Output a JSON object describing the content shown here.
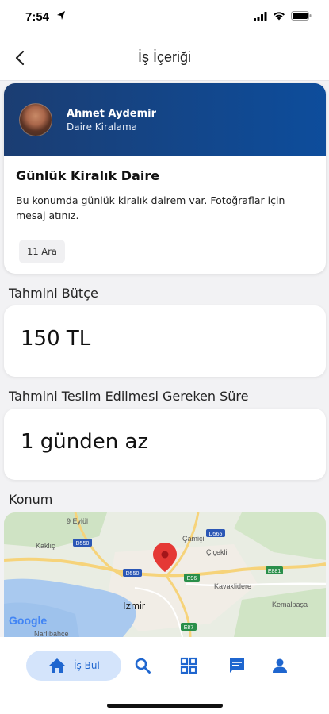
{
  "status_bar": {
    "time": "7:54"
  },
  "nav": {
    "title": "İş İçeriği"
  },
  "job": {
    "user_name": "Ahmet Aydemir",
    "user_category": "Daire Kiralama",
    "title": "Günlük Kiralık Daire",
    "description": "Bu konumda günlük kiralık dairem var. Fotoğraflar için mesaj atınız.",
    "date": "11 Ara"
  },
  "budget": {
    "label": "Tahmini Bütçe",
    "value": "150 TL"
  },
  "duration": {
    "label": "Tahmini Teslim Edilmesi Gereken Süre",
    "value": "1 günden az"
  },
  "location": {
    "label": "Konum",
    "map_labels": {
      "eylul": "9 Eylül",
      "camici": "Çamiçi",
      "kaklic": "Kaklıç",
      "cicekli": "Çiçekli",
      "kavaklidere": "Kavaklidere",
      "izmir": "İzmir",
      "kemalpasa": "Kemalpaşa",
      "narlibahce": "Narlıbahçe",
      "google": "Google",
      "d565": "D565",
      "d550_top": "D550",
      "d550_mid": "D550",
      "e881": "E881",
      "e96": "E96",
      "e87": "E87"
    }
  },
  "bottom_nav": {
    "active_label": "İş Bul"
  },
  "colors": {
    "accent": "#1f66cf",
    "header": "#0d4d9c",
    "pin": "#e53935"
  }
}
